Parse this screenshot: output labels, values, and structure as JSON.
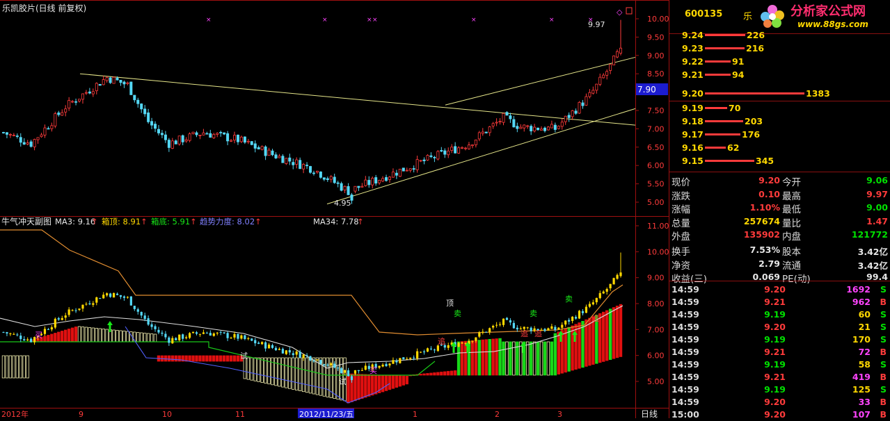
{
  "main_chart": {
    "title": "乐凯胶片(日线 前复权)",
    "axis_labels": [
      "10.00",
      "9.50",
      "9.00",
      "8.50",
      "8.00",
      "7.50",
      "7.00",
      "6.50",
      "6.00",
      "5.50",
      "5.00"
    ],
    "current_price_tag": "7.90",
    "high_label": "9.97",
    "low_label": "4.95"
  },
  "indicator": {
    "title": "牛气冲天副图",
    "ma3": "MA3: 9.16",
    "box_top": "箱顶: 8.91",
    "box_bottom": "箱底: 5.91",
    "trend": "趋势力度: 8.02",
    "ma34": "MA34: 7.78",
    "axis_labels": [
      "11.00",
      "10.00",
      "9.00",
      "8.00",
      "7.00",
      "6.00",
      "5.00"
    ],
    "signals": {
      "buy": "买",
      "sell": "卖",
      "top": "顶",
      "chase": "追",
      "try": "试"
    }
  },
  "date_axis": {
    "labels": [
      "2012年",
      "9",
      "10",
      "11",
      "2012/11/23/五",
      "1",
      "2",
      "3"
    ],
    "period": "日线"
  },
  "colors": {
    "up": "#ff3b3b",
    "down": "#54d8f5",
    "ma_white": "#e0e0e0",
    "ma_orange": "#e08c30",
    "channel": "#e6e68a",
    "box_green": "#18c818",
    "stripe": "#f2eeb0"
  },
  "stock": {
    "code": "600135",
    "name": "乐"
  },
  "logo": {
    "title": "分析家公式网",
    "url": "www.88gs.com"
  },
  "orderbook": {
    "asks": [
      {
        "price": "9.24",
        "vol": "226"
      },
      {
        "price": "9.23",
        "vol": "216"
      },
      {
        "price": "9.22",
        "vol": "91"
      },
      {
        "price": "9.21",
        "vol": "94"
      },
      {
        "price": "9.20",
        "vol": "1383"
      }
    ],
    "bids": [
      {
        "price": "9.19",
        "vol": "70"
      },
      {
        "price": "9.18",
        "vol": "203"
      },
      {
        "price": "9.17",
        "vol": "176"
      },
      {
        "price": "9.16",
        "vol": "62"
      },
      {
        "price": "9.15",
        "vol": "345"
      }
    ]
  },
  "quote": {
    "rows": [
      {
        "l1": "现价",
        "v1": "9.20",
        "l2": "今开",
        "v2": "9.06"
      },
      {
        "l1": "涨跌",
        "v1": "0.10",
        "l2": "最高",
        "v2": "9.97"
      },
      {
        "l1": "涨幅",
        "v1": "1.10%",
        "l2": "最低",
        "v2": "9.00"
      },
      {
        "l1": "总量",
        "v1": "257674",
        "l2": "量比",
        "v2": "1.47"
      },
      {
        "l1": "外盘",
        "v1": "135902",
        "l2": "内盘",
        "v2": "121772"
      },
      {
        "l1": "换手",
        "v1": "7.53%",
        "l2": "股本",
        "v2": "3.42亿"
      },
      {
        "l1": "净资",
        "v1": "2.79",
        "l2": "流通",
        "v2": "3.42亿"
      },
      {
        "l1": "收益(三)",
        "v1": "0.069",
        "l2": "PE(动)",
        "v2": "99.4"
      }
    ]
  },
  "ticks": [
    {
      "time": "14:59",
      "price": "9.20",
      "vol": "1692",
      "bs": "S"
    },
    {
      "time": "14:59",
      "price": "9.21",
      "vol": "962",
      "bs": "B"
    },
    {
      "time": "14:59",
      "price": "9.19",
      "vol": "60",
      "bs": "S"
    },
    {
      "time": "14:59",
      "price": "9.20",
      "vol": "21",
      "bs": "S"
    },
    {
      "time": "14:59",
      "price": "9.19",
      "vol": "170",
      "bs": "S"
    },
    {
      "time": "14:59",
      "price": "9.21",
      "vol": "72",
      "bs": "B"
    },
    {
      "time": "14:59",
      "price": "9.19",
      "vol": "58",
      "bs": "S"
    },
    {
      "time": "14:59",
      "price": "9.21",
      "vol": "419",
      "bs": "B"
    },
    {
      "time": "14:59",
      "price": "9.19",
      "vol": "125",
      "bs": "S"
    },
    {
      "time": "14:59",
      "price": "9.20",
      "vol": "33",
      "bs": "B"
    },
    {
      "time": "15:00",
      "price": "9.20",
      "vol": "107",
      "bs": "B"
    }
  ]
}
